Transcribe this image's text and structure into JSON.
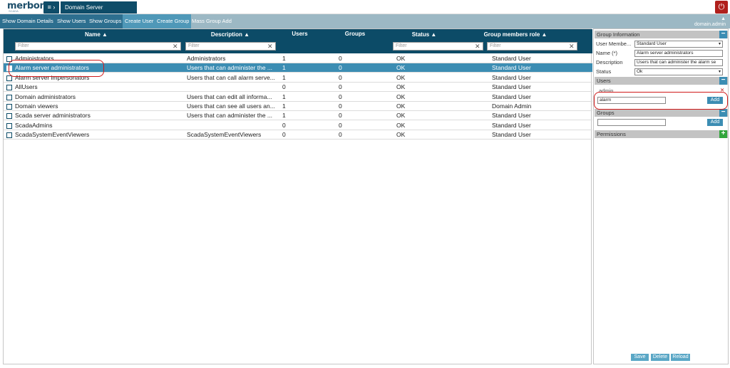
{
  "header": {
    "logo": "merbon",
    "logo_sub": "SCADA",
    "menu_icon": "hamburger-icon",
    "menu_glyph": "≡ ›",
    "title": "Domain Server",
    "power_glyph": "⏻"
  },
  "toolbar": {
    "buttons": [
      "Show Domain Details",
      "Show Users",
      "Show Groups",
      "Create User",
      "Create Group",
      "Mass Group Add"
    ],
    "user_icon": "user-icon",
    "user_glyph": "▲",
    "user": "domain.admin"
  },
  "grid": {
    "columns": [
      "Name ▲",
      "Description ▲",
      "Users",
      "Groups",
      "Status ▲",
      "Group members role ▲"
    ],
    "filter_placeholder": "Filter",
    "clear_glyph": "✕",
    "rows": [
      {
        "name": "Administrators",
        "description": "Administrators",
        "users": "1",
        "groups": "0",
        "status": "OK",
        "role": "Standard User",
        "selected": false
      },
      {
        "name": "Alarm server administrators",
        "description": "Users that can administer the ...",
        "users": "1",
        "groups": "0",
        "status": "OK",
        "role": "Standard User",
        "selected": true
      },
      {
        "name": "Alarm server impersonators",
        "description": "Users that can call alarm serve...",
        "users": "1",
        "groups": "0",
        "status": "OK",
        "role": "Standard User",
        "selected": false
      },
      {
        "name": "AllUsers",
        "description": "",
        "users": "0",
        "groups": "0",
        "status": "OK",
        "role": "Standard User",
        "selected": false
      },
      {
        "name": "Domain administrators",
        "description": "Users that can edit all informa...",
        "users": "1",
        "groups": "0",
        "status": "OK",
        "role": "Standard User",
        "selected": false
      },
      {
        "name": "Domain viewers",
        "description": "Users that can see all users an...",
        "users": "1",
        "groups": "0",
        "status": "OK",
        "role": "Domain Admin",
        "selected": false
      },
      {
        "name": "Scada server administrators",
        "description": "Users that can administer the ...",
        "users": "1",
        "groups": "0",
        "status": "OK",
        "role": "Standard User",
        "selected": false
      },
      {
        "name": "ScadaAdmins",
        "description": "",
        "users": "0",
        "groups": "0",
        "status": "OK",
        "role": "Standard User",
        "selected": false
      },
      {
        "name": "ScadaSystemEventViewers",
        "description": "ScadaSystemEventViewers",
        "users": "0",
        "groups": "0",
        "status": "OK",
        "role": "Standard User",
        "selected": false
      }
    ]
  },
  "panel": {
    "group_info": {
      "title": "Group Information",
      "collapse_glyph": "−",
      "member_label": "User Membe...",
      "member_value": "Standard User",
      "name_label": "Name (*)",
      "name_value": "Alarm server administrators",
      "desc_label": "Description",
      "desc_value": "Users that can administer the alarm se",
      "status_label": "Status",
      "status_value": "Ok",
      "dropdown_glyph": "▾"
    },
    "users": {
      "title": "Users",
      "collapse_glyph": "−",
      "member": "admin",
      "remove_glyph": "✕",
      "input_value": "alarm",
      "add_label": "Add"
    },
    "groups": {
      "title": "Groups",
      "collapse_glyph": "−",
      "input_value": "",
      "add_label": "Add"
    },
    "permissions": {
      "title": "Permissions",
      "expand_glyph": "+"
    },
    "footer": {
      "save": "Save",
      "delete": "Delete",
      "reload": "Reload"
    }
  },
  "colors": {
    "header_dark": "#0c4b67",
    "toolbar": "#9cb8c4",
    "selected_row": "#3c8db3",
    "power": "#b0201c",
    "annotation": "#d01a1a"
  }
}
